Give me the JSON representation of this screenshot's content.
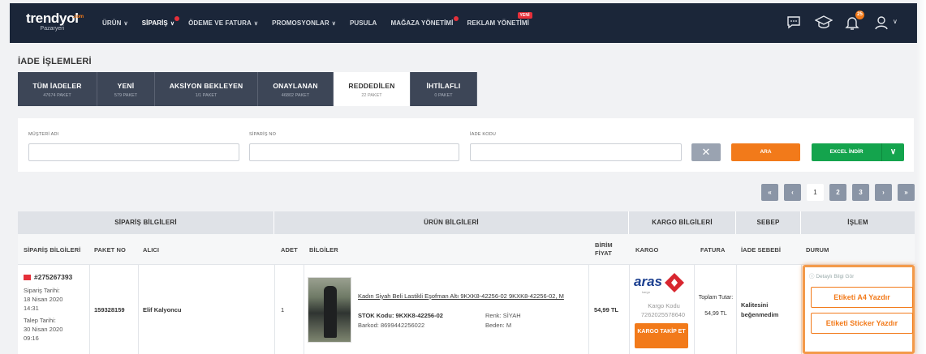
{
  "logo": {
    "name": "trendyol",
    "com": ".com",
    "sub": "Pazaryeri"
  },
  "nav": [
    {
      "label": "ÜRÜN",
      "chev": "∨"
    },
    {
      "label": "SİPARİŞ",
      "chev": "∨",
      "active": true,
      "dot": true
    },
    {
      "label": "ÖDEME VE FATURA",
      "chev": "∨"
    },
    {
      "label": "PROMOSYONLAR",
      "chev": "∨"
    },
    {
      "label": "PUSULA",
      "chev": ""
    },
    {
      "label": "MAĞAZA YÖNETİMİ",
      "chev": "",
      "dot": true
    },
    {
      "label": "REKLAM YÖNETİMİ",
      "chev": "",
      "yeni": "YENİ"
    }
  ],
  "header": {
    "bell_badge": "25",
    "user_chev": "∨"
  },
  "page_title": "İADE İŞLEMLERİ",
  "tabs": [
    {
      "title": "TÜM İADELER",
      "count": "47674 PAKET",
      "w": 98
    },
    {
      "title": "YENİ",
      "count": "579 PAKET",
      "w": 71
    },
    {
      "title": "AKSİYON BEKLEYEN",
      "count": "1/1 PAKET",
      "w": 127
    },
    {
      "title": "ONAYLANAN",
      "count": "46802 PAKET",
      "w": 93
    },
    {
      "title": "REDDEDİLEN",
      "count": "22 PAKET",
      "w": 95,
      "active": true
    },
    {
      "title": "İHTİLAFLI",
      "count": "0 PAKET",
      "w": 82
    }
  ],
  "filter": {
    "musteri_label": "MÜŞTERİ ADI",
    "siparis_label": "SİPARİŞ NO",
    "iade_label": "İADE KODU",
    "clear": "✕",
    "search": "ARA",
    "excel": "EXCEL İNDİR",
    "excel_chev": "∨"
  },
  "pager": {
    "first": "«",
    "prev": "‹",
    "pages": [
      "1",
      "2",
      "3"
    ],
    "next": "›",
    "last": "»"
  },
  "table": {
    "groups": [
      "SİPARİŞ BİLGİLERİ",
      "ÜRÜN BİLGİLERİ",
      "KARGO BİLGİLERİ",
      "SEBEP",
      "İŞLEM"
    ],
    "cols": [
      "SİPARİŞ BİLGİLERİ",
      "PAKET NO",
      "ALICI",
      "ADET",
      "BİLGİLER",
      "BİRİM FİYAT",
      "KARGO",
      "FATURA",
      "İADE SEBEBİ",
      "DURUM"
    ],
    "row": {
      "order_no": "#275267393",
      "order_date_label": "Sipariş Tarihi:",
      "order_date": "18 Nisan 2020",
      "order_time": "14:31",
      "request_label": "Talep Tarihi:",
      "request_date": "30 Nisan 2020",
      "request_time": "09:16",
      "package_no": "159328159",
      "buyer": "Elif Kalyoncu",
      "qty": "1",
      "product_name": "Kadın Siyah Beli Lastikli Eşofman Altı 9KXK8-42256-02 9KXK8-42256-02, M",
      "stock_label": "STOK Kodu:",
      "stock_code": "9KXK8-42256-02",
      "barcode_label": "Barkod:",
      "barcode": "8699442256022",
      "color_label": "Renk:",
      "color": "SİYAH",
      "size_label": "Beden:",
      "size": "M",
      "unit_price": "54,99 TL",
      "cargo_code_label": "Kargo Kodu",
      "cargo_code": "7262025578640",
      "cargo_btn": "KARGO TAKİP ET",
      "invoice_label": "Toplam Tutar:",
      "invoice_total": "54,99 TL",
      "reason": "Kalitesini beğenmedim",
      "detail_link": "Detaylı Bilgi Gör",
      "btn_a4": "Etiketi A4 Yazdır",
      "btn_sticker": "Etiketi Sticker Yazdır"
    }
  },
  "colors": {
    "nav_bg": "#1b2639",
    "accent": "#f27a1a",
    "green": "#14a44d",
    "tab_bg": "#3d4657"
  }
}
